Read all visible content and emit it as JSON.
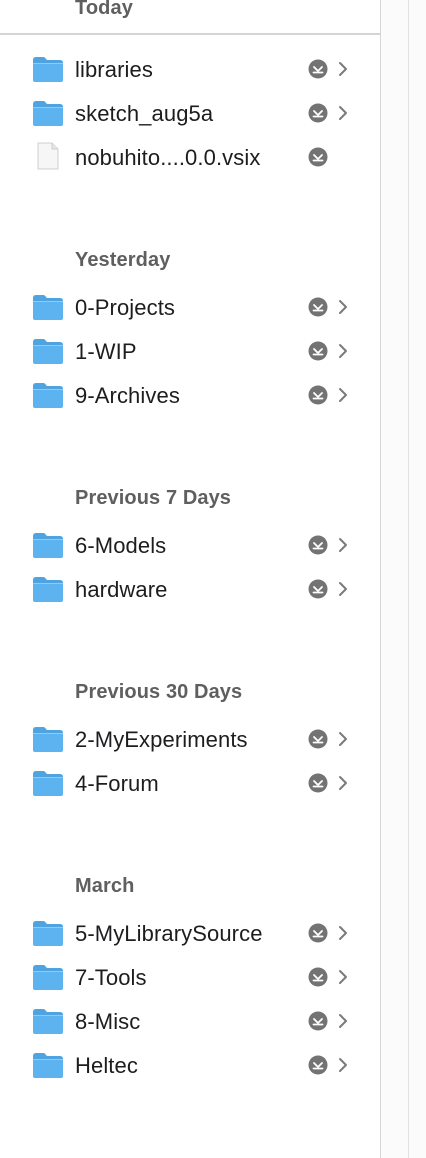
{
  "sections": [
    {
      "header": "Today",
      "items": [
        {
          "label": "libraries",
          "kind": "folder",
          "icon": "folder-icon",
          "status": "cloud-downloaded-icon",
          "has_chevron": true
        },
        {
          "label": "sketch_aug5a",
          "kind": "folder",
          "icon": "folder-icon",
          "status": "cloud-downloaded-icon",
          "has_chevron": true
        },
        {
          "label": "nobuhito....0.0.vsix",
          "kind": "file",
          "icon": "document-icon",
          "status": "cloud-downloaded-icon",
          "has_chevron": false
        }
      ]
    },
    {
      "header": "Yesterday",
      "items": [
        {
          "label": "0-Projects",
          "kind": "folder",
          "icon": "folder-icon",
          "status": "cloud-downloaded-icon",
          "has_chevron": true
        },
        {
          "label": "1-WIP",
          "kind": "folder",
          "icon": "folder-icon",
          "status": "cloud-downloaded-icon",
          "has_chevron": true
        },
        {
          "label": "9-Archives",
          "kind": "folder",
          "icon": "folder-icon",
          "status": "cloud-downloaded-icon",
          "has_chevron": true
        }
      ]
    },
    {
      "header": "Previous 7 Days",
      "items": [
        {
          "label": "6-Models",
          "kind": "folder",
          "icon": "folder-icon",
          "status": "cloud-downloaded-icon",
          "has_chevron": true
        },
        {
          "label": "hardware",
          "kind": "folder",
          "icon": "folder-icon",
          "status": "cloud-downloaded-icon",
          "has_chevron": true
        }
      ]
    },
    {
      "header": "Previous 30 Days",
      "items": [
        {
          "label": "2-MyExperiments",
          "kind": "folder",
          "icon": "folder-icon",
          "status": "cloud-downloaded-icon",
          "has_chevron": true
        },
        {
          "label": "4-Forum",
          "kind": "folder",
          "icon": "folder-icon",
          "status": "cloud-downloaded-icon",
          "has_chevron": true
        }
      ]
    },
    {
      "header": "March",
      "items": [
        {
          "label": "5-MyLibrarySource",
          "kind": "folder",
          "icon": "folder-icon",
          "status": "cloud-downloaded-icon",
          "has_chevron": true
        },
        {
          "label": "7-Tools",
          "kind": "folder",
          "icon": "folder-icon",
          "status": "cloud-downloaded-icon",
          "has_chevron": true
        },
        {
          "label": "8-Misc",
          "kind": "folder",
          "icon": "folder-icon",
          "status": "cloud-downloaded-icon",
          "has_chevron": true
        },
        {
          "label": "Heltec",
          "kind": "folder",
          "icon": "folder-icon",
          "status": "cloud-downloaded-icon",
          "has_chevron": true
        }
      ]
    }
  ],
  "colors": {
    "folder_body": "#5cb3ef",
    "folder_tab": "#4fa3e0",
    "status_badge": "#737373",
    "chevron": "#7a7a7a",
    "header_text": "#5f5f5f",
    "label_text": "#1d1d1f"
  }
}
